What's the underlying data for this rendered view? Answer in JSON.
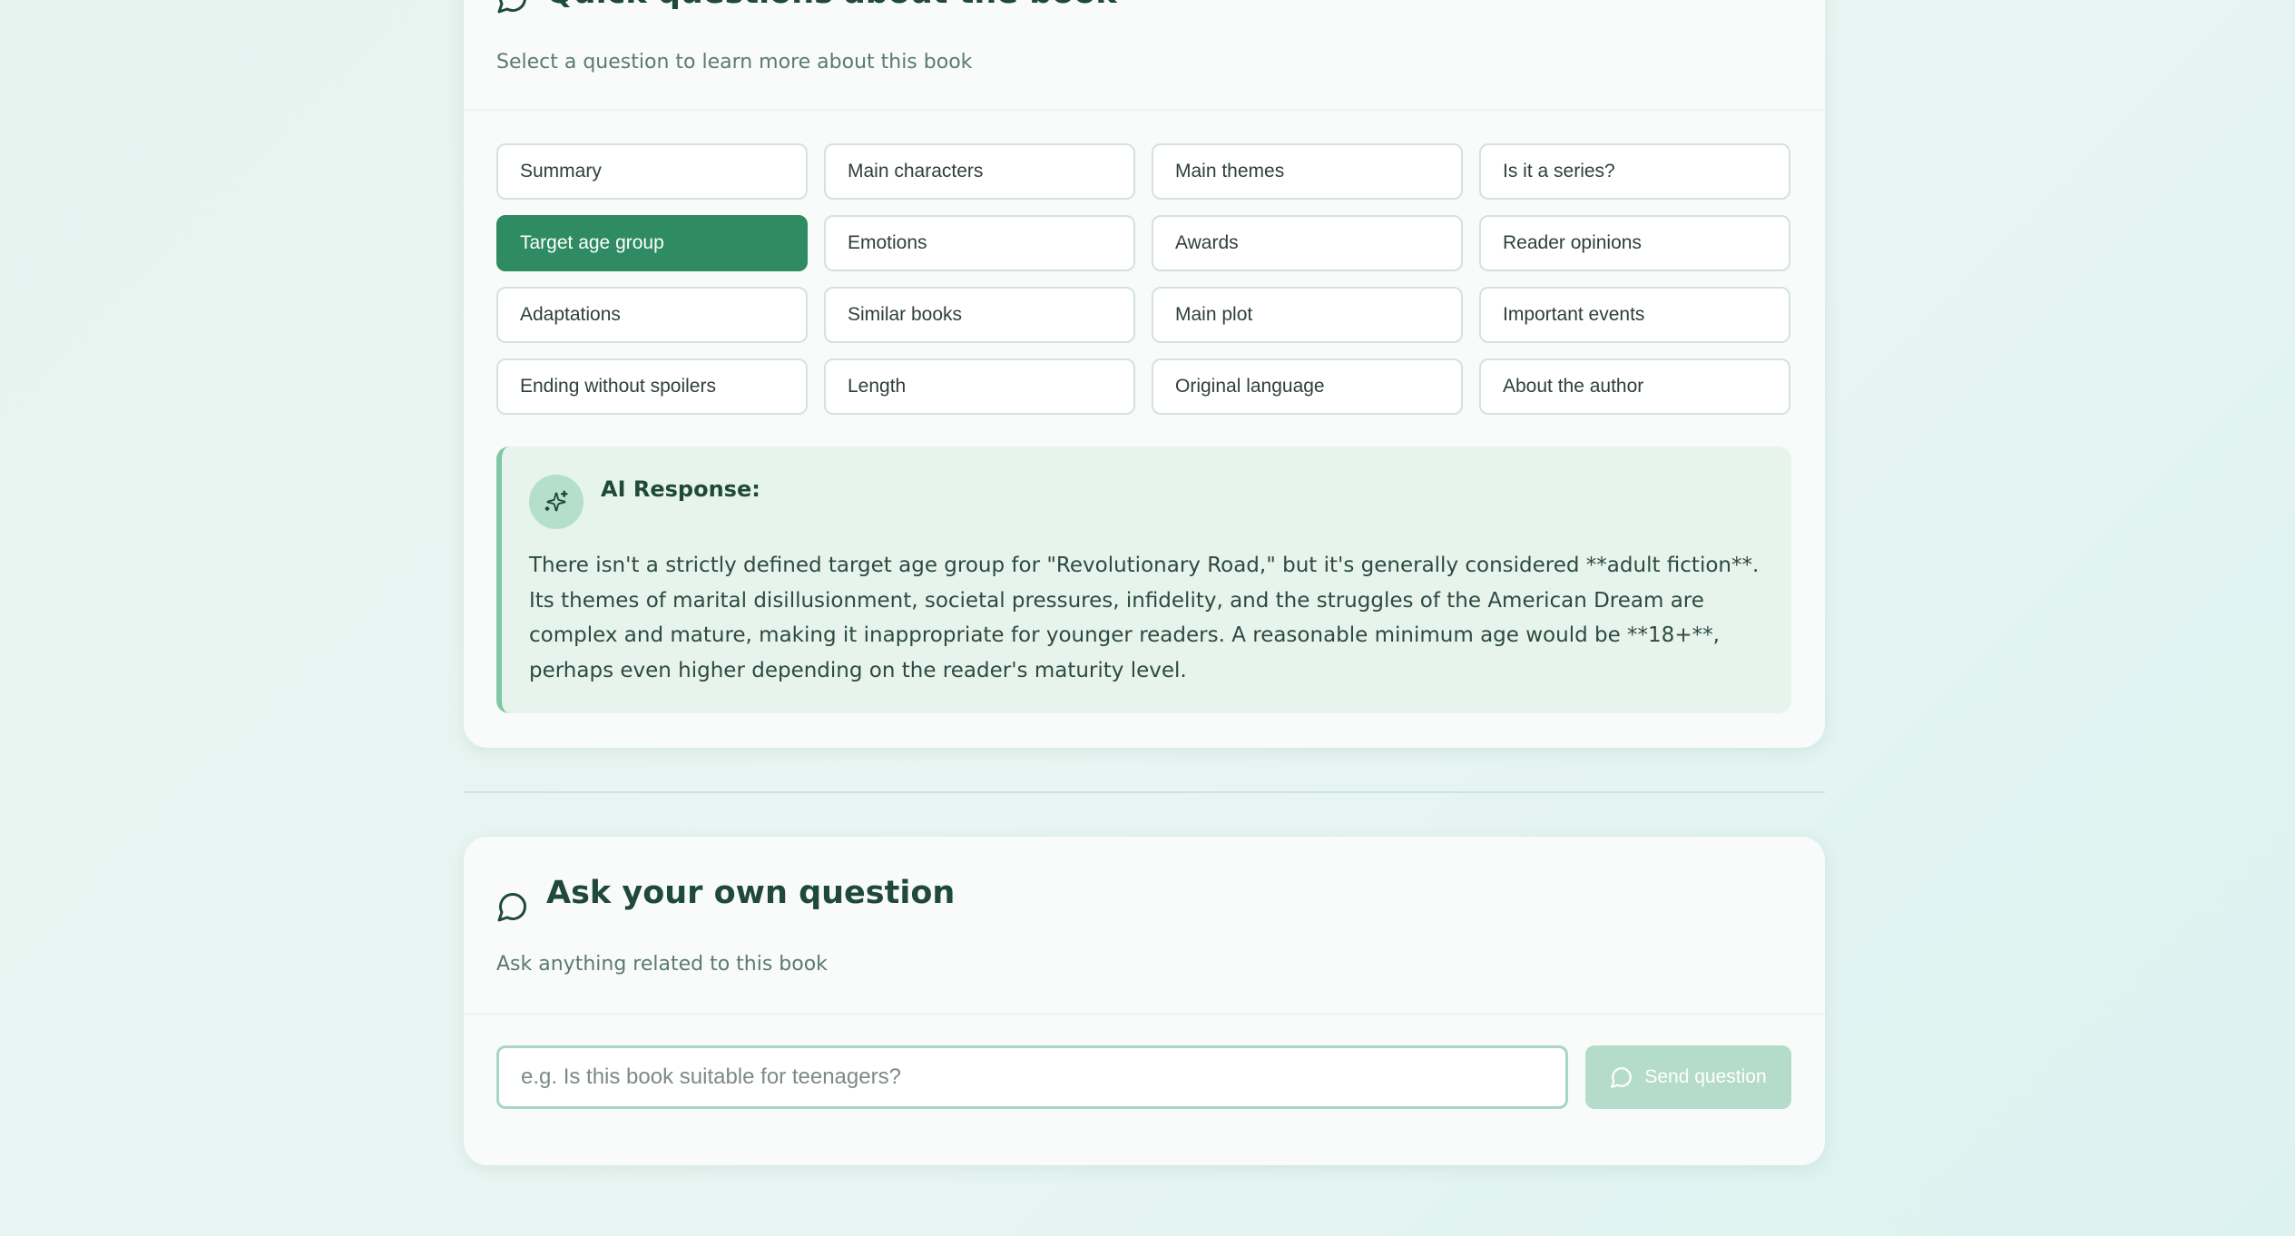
{
  "quick_questions": {
    "title": "Quick questions about the book",
    "subtitle": "Select a question to learn more about this book",
    "icon": "message-circle-icon",
    "buttons": [
      {
        "label": "Summary",
        "active": false
      },
      {
        "label": "Main characters",
        "active": false
      },
      {
        "label": "Main themes",
        "active": false
      },
      {
        "label": "Is it a series?",
        "active": false
      },
      {
        "label": "Target age group",
        "active": true
      },
      {
        "label": "Emotions",
        "active": false
      },
      {
        "label": "Awards",
        "active": false
      },
      {
        "label": "Reader opinions",
        "active": false
      },
      {
        "label": "Adaptations",
        "active": false
      },
      {
        "label": "Similar books",
        "active": false
      },
      {
        "label": "Main plot",
        "active": false
      },
      {
        "label": "Important events",
        "active": false
      },
      {
        "label": "Ending without spoilers",
        "active": false
      },
      {
        "label": "Length",
        "active": false
      },
      {
        "label": "Original language",
        "active": false
      },
      {
        "label": "About the author",
        "active": false
      }
    ],
    "ai_response": {
      "label": "AI Response:",
      "icon": "sparkles-icon",
      "text": "There isn't a strictly defined target age group for \"Revolutionary Road,\" but it's generally considered **adult fiction**. Its themes of marital disillusionment, societal pressures, infidelity, and the struggles of the American Dream are complex and mature, making it inappropriate for younger readers. A reasonable minimum age would be **18+**, perhaps even higher depending on the reader's maturity level."
    }
  },
  "own_question": {
    "title": "Ask your own question",
    "subtitle": "Ask anything related to this book",
    "icon": "message-circle-icon",
    "input": {
      "value": "",
      "placeholder": "e.g. Is this book suitable for teenagers?"
    },
    "send_label": "Send question",
    "send_icon": "message-circle-icon"
  },
  "colors": {
    "accent": "#2e8b62",
    "accent_disabled": "#b5dccb",
    "title_text": "#1f4a3a",
    "response_bg": "#e7f4ee",
    "response_border": "#7fc7a5"
  }
}
